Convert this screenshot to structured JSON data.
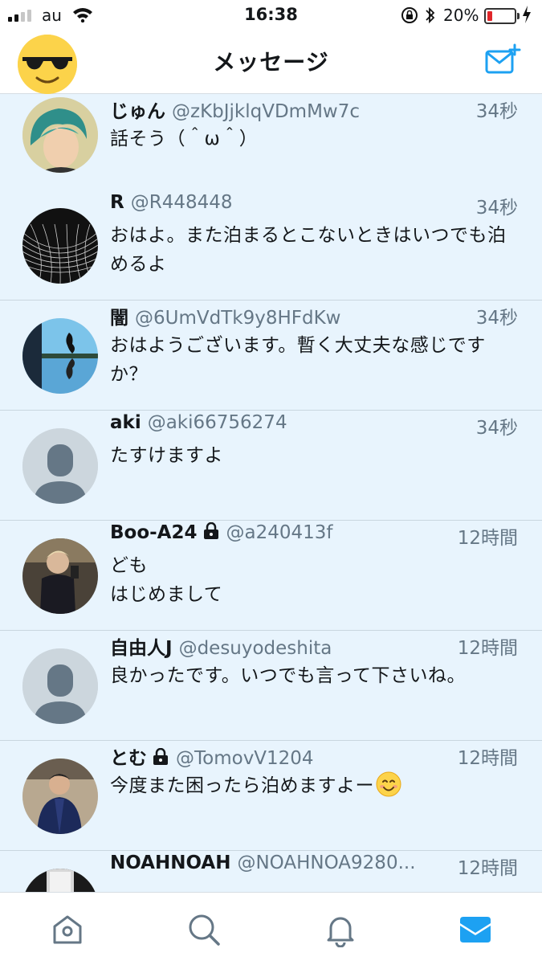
{
  "status_bar": {
    "carrier": "au",
    "time": "16:38",
    "battery_percent": "20%",
    "battery_level": 0.2,
    "signal_bars": 2
  },
  "nav": {
    "title": "メッセージ",
    "icons": {
      "avatar": "sunglasses-emoji-avatar",
      "compose": "compose-message-icon"
    }
  },
  "conversations": [
    {
      "name": "じゅん",
      "handle": "@zKbJjklqVDmMw7c",
      "time": "34秒",
      "message": "話そう（＾ω＾）",
      "locked": false,
      "avatar": "photo-teal-hair"
    },
    {
      "name": "R",
      "handle": "@R448448",
      "time": "34秒",
      "message": "おはよ。また泊まるとこないときはいつでも泊めるよ",
      "locked": false,
      "avatar": "photo-wireframe-grid"
    },
    {
      "name": "闇",
      "handle": "@6UmVdTk9y8HFdKw",
      "time": "34秒",
      "message": "おはようございます。暫く大丈夫な感じですか？",
      "locked": false,
      "avatar": "photo-reflection"
    },
    {
      "name": "aki",
      "handle": "@aki66756274",
      "time": "34秒",
      "message": "たすけますよ",
      "locked": false,
      "avatar": "default-avatar"
    },
    {
      "name": "Boo-A24",
      "handle": "@a240413f",
      "time": "12時間",
      "message_lines": [
        "ども",
        "はじめまして"
      ],
      "locked": true,
      "avatar": "photo-mirror-selfie"
    },
    {
      "name": "自由人J",
      "handle": "@desuyodeshita",
      "time": "12時間",
      "message": "良かったです。いつでも言って下さいね。",
      "locked": false,
      "avatar": "default-avatar"
    },
    {
      "name": "とむ",
      "handle": "@TomovV1204",
      "time": "12時間",
      "message": "今度また困ったら泊めますよー",
      "emoji": "smiling-face-emoji",
      "locked": true,
      "avatar": "photo-man-jacket"
    },
    {
      "name": "NOAHNOAH",
      "handle": "@NOAHNOA9280...",
      "time": "12時間",
      "message": "",
      "locked": false,
      "avatar": "photo-dark"
    }
  ],
  "tab_bar": {
    "tabs": [
      "home-icon",
      "search-icon",
      "notifications-icon",
      "messages-icon"
    ],
    "active": "messages-icon",
    "colors": {
      "active": "#1da1f2",
      "inactive": "#657786"
    }
  },
  "colors": {
    "list_background": "#e8f4fd",
    "accent": "#1da1f2",
    "secondary_text": "#657786"
  }
}
